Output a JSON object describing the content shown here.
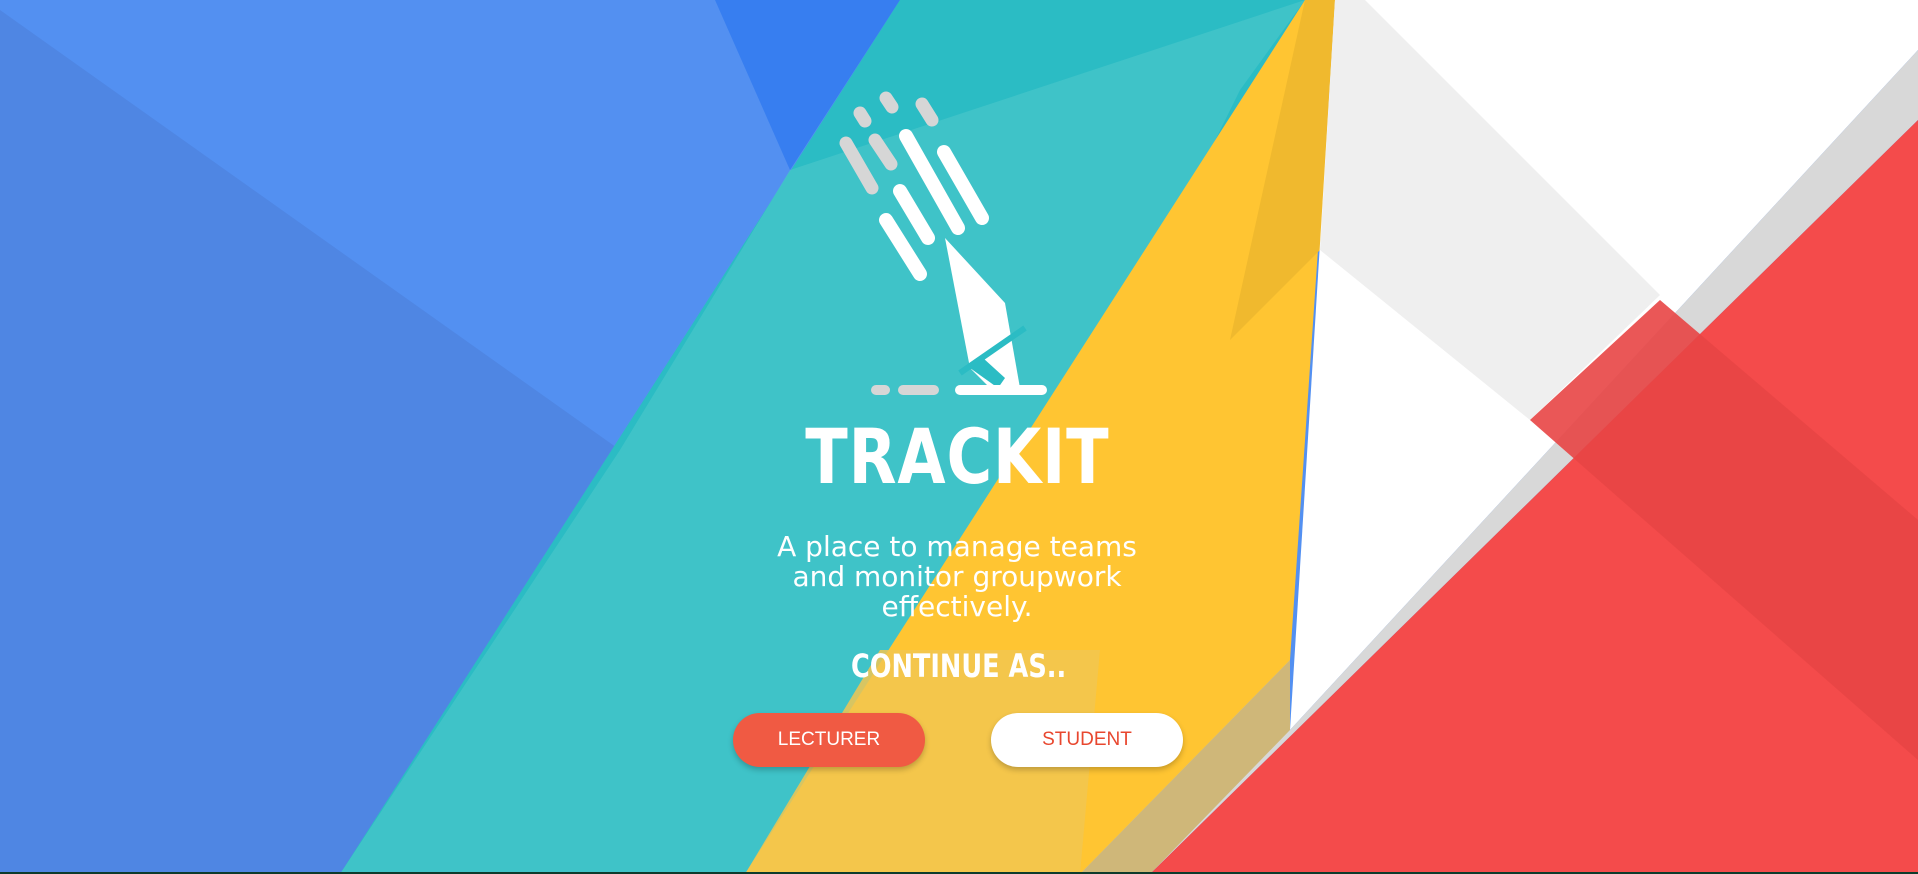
{
  "app": {
    "brand": "TRACKIT",
    "tagline": "A place to manage teams and monitor groupwork effectively.",
    "continue_label": "CONTINUE AS.."
  },
  "buttons": {
    "lecturer": "LECTURER",
    "student": "STUDENT"
  },
  "icons": {
    "logo": "pencil-writing-icon"
  },
  "colors": {
    "blue": "#5390f1",
    "teal": "#2bbcc4",
    "yellow": "#ffc532",
    "red": "#f44b4b",
    "white": "#ffffff",
    "lecturer_button": "#f05a43",
    "student_button_text": "#e8472f"
  }
}
